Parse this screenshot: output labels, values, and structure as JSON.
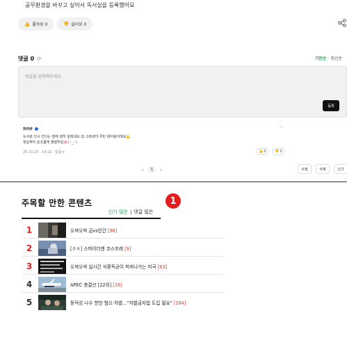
{
  "post": {
    "text": "공무환경을 바꾸고 싶어서 독서실을 등록했어요"
  },
  "votes": {
    "like_label": "좋아요 0",
    "dislike_label": "싫어요 0"
  },
  "comments": {
    "title": "댓글 0",
    "sort_active": "기본순",
    "sort_inactive": "최신순",
    "placeholder": "댓글을 입력해주세요.",
    "submit_label": "등록",
    "items": [
      {
        "author": "파리바",
        "line1": "도서관 다시 간다는 말에 괜히 설레네요 😊 스파르타 루틴 화이팅이에요💪",
        "line2": "첫날부터 순조롭게 출발하길🌸( -_- )",
        "meta": "25.10.25 · 14:22 · 답글 ▾",
        "like": "0",
        "dislike": "0"
      }
    ],
    "pager_current": "1",
    "edit_label": "수정",
    "delete_label": "삭제",
    "report_label": "신고"
  },
  "featured": {
    "title": "주목할 만한 콘텐츠",
    "marker": "1",
    "tab_active": "인기 많은",
    "tab_sep": "|",
    "tab_inactive": "댓글 많은",
    "items": [
      {
        "rank": "1",
        "title": "오싹오싹 곰vs인간",
        "count": "[96]"
      },
      {
        "rank": "2",
        "title": "[ㅇㅊ] 스파이더맨 코스프레",
        "count": "[9]"
      },
      {
        "rank": "3",
        "title": "오싹오싹 실시간 식중독균이 퍼져나가는 미국",
        "count": "[63]"
      },
      {
        "rank": "4",
        "title": "APEC 총결산 [22위]",
        "count": "[16]"
      },
      {
        "rank": "5",
        "title": "동덕성 나수 향한 혐오·차별…\"차별금지법 도입 필요\"",
        "count": "[184]"
      }
    ]
  },
  "colors": {
    "accent_green": "#2aa05a",
    "rank_red": "#e41e1e",
    "count_red": "#e03a2e"
  }
}
